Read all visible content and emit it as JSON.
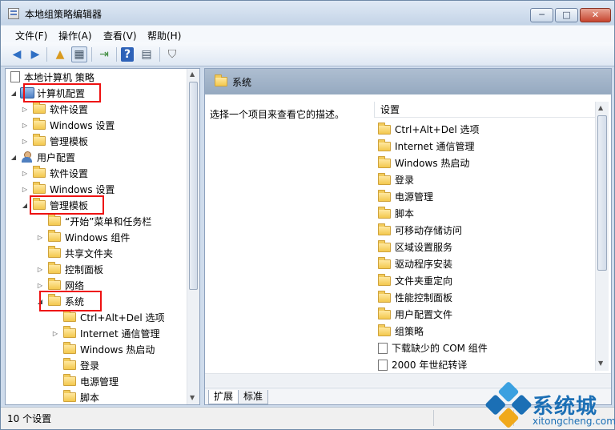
{
  "window": {
    "title": "本地组策略编辑器",
    "min": "─",
    "max": "□",
    "close": "✕"
  },
  "menu": [
    "文件(F)",
    "操作(A)",
    "查看(V)",
    "帮助(H)"
  ],
  "toolbar": {
    "back": "◀",
    "forward": "▶",
    "up": "▲",
    "console": "▦",
    "export": "⇥",
    "help": "?",
    "props": "▤",
    "filter": "⛉"
  },
  "tree": {
    "root": "本地计算机 策略",
    "items": [
      {
        "label": "计算机配置",
        "kind": "computer",
        "toggle": "◢"
      },
      {
        "label": "软件设置",
        "kind": "folder",
        "toggle": "▷"
      },
      {
        "label": "Windows 设置",
        "kind": "folder",
        "toggle": "▷"
      },
      {
        "label": "管理模板",
        "kind": "folder",
        "toggle": "▷"
      },
      {
        "label": "用户配置",
        "kind": "user",
        "toggle": "◢"
      },
      {
        "label": "软件设置",
        "kind": "folder",
        "toggle": "▷"
      },
      {
        "label": "Windows 设置",
        "kind": "folder",
        "toggle": "▷"
      },
      {
        "label": "管理模板",
        "kind": "folder",
        "toggle": "◢"
      },
      {
        "label": "“开始”菜单和任务栏",
        "kind": "folder",
        "toggle": ""
      },
      {
        "label": "Windows 组件",
        "kind": "folder",
        "toggle": "▷"
      },
      {
        "label": "共享文件夹",
        "kind": "folder",
        "toggle": ""
      },
      {
        "label": "控制面板",
        "kind": "folder",
        "toggle": "▷"
      },
      {
        "label": "网络",
        "kind": "folder",
        "toggle": "▷"
      },
      {
        "label": "系统",
        "kind": "folder",
        "toggle": "◢"
      },
      {
        "label": "Ctrl+Alt+Del 选项",
        "kind": "folder",
        "toggle": ""
      },
      {
        "label": "Internet 通信管理",
        "kind": "folder",
        "toggle": "▷"
      },
      {
        "label": "Windows 热启动",
        "kind": "folder",
        "toggle": ""
      },
      {
        "label": "登录",
        "kind": "folder",
        "toggle": ""
      },
      {
        "label": "电源管理",
        "kind": "folder",
        "toggle": ""
      },
      {
        "label": "脚本",
        "kind": "folder",
        "toggle": ""
      }
    ]
  },
  "detail": {
    "header": "系统",
    "description": "选择一个项目来查看它的描述。",
    "column": "设置",
    "items": [
      {
        "label": "Ctrl+Alt+Del 选项",
        "kind": "folder"
      },
      {
        "label": "Internet 通信管理",
        "kind": "folder"
      },
      {
        "label": "Windows 热启动",
        "kind": "folder"
      },
      {
        "label": "登录",
        "kind": "folder"
      },
      {
        "label": "电源管理",
        "kind": "folder"
      },
      {
        "label": "脚本",
        "kind": "folder"
      },
      {
        "label": "可移动存储访问",
        "kind": "folder"
      },
      {
        "label": "区域设置服务",
        "kind": "folder"
      },
      {
        "label": "驱动程序安装",
        "kind": "folder"
      },
      {
        "label": "文件夹重定向",
        "kind": "folder"
      },
      {
        "label": "性能控制面板",
        "kind": "folder"
      },
      {
        "label": "用户配置文件",
        "kind": "folder"
      },
      {
        "label": "组策略",
        "kind": "folder"
      },
      {
        "label": "下载缺少的 COM 组件",
        "kind": "setting"
      },
      {
        "label": "2000 年世纪转译",
        "kind": "setting"
      }
    ],
    "tabs": [
      "扩展",
      "标准"
    ]
  },
  "status": {
    "text": "10 个设置"
  },
  "watermark": {
    "brand": "系统城",
    "url": "xitongcheng.com"
  },
  "colors": {
    "highlight_box": "#ee1111",
    "brand": "#1b6fb5"
  }
}
